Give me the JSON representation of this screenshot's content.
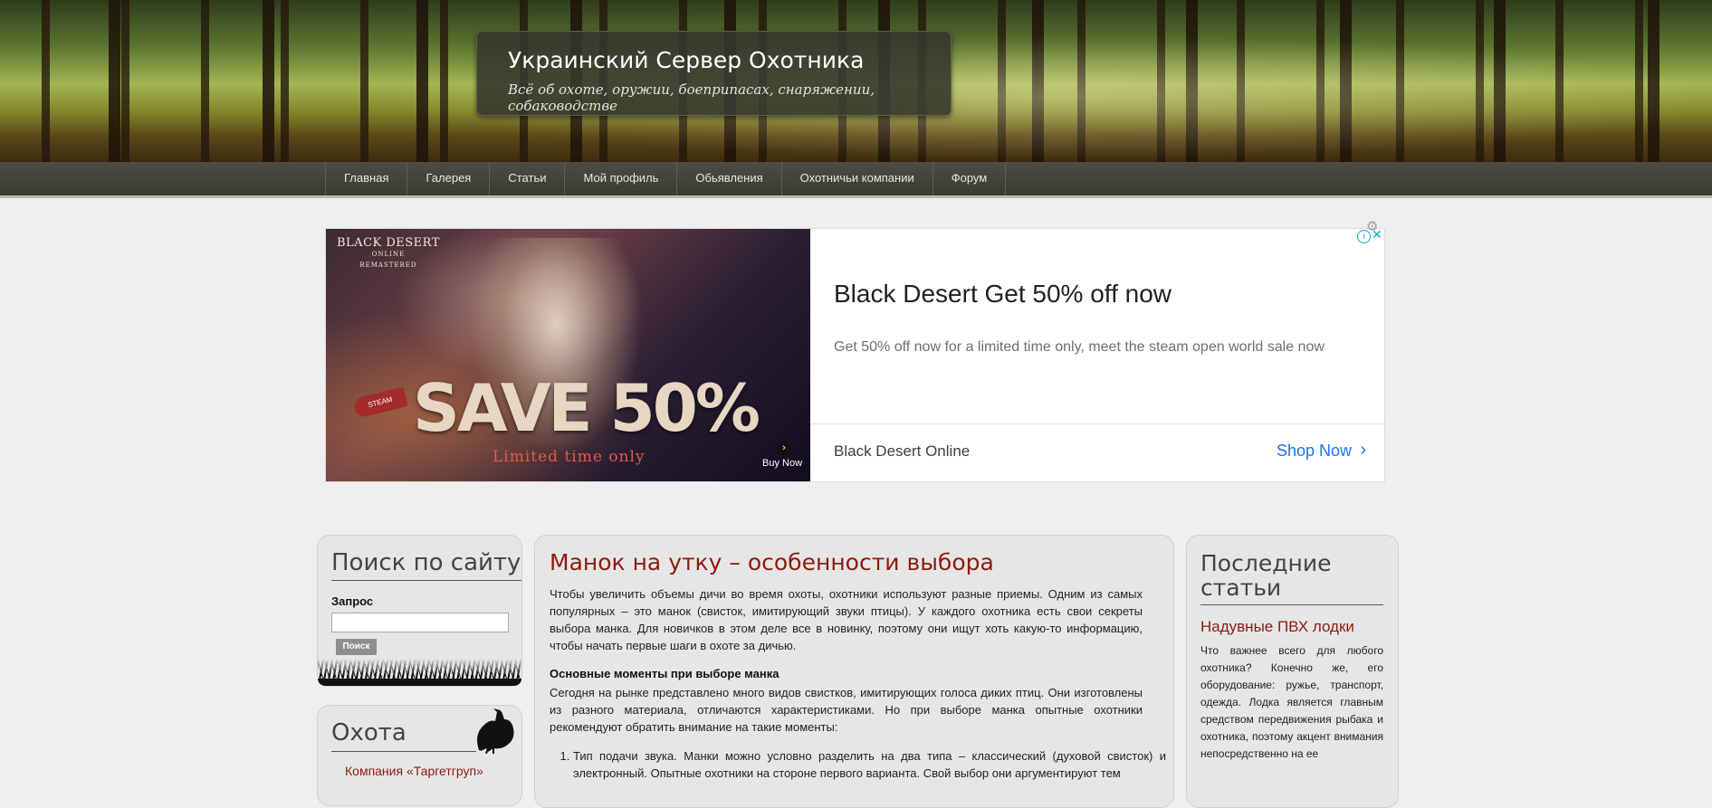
{
  "site": {
    "title": "Украинский Сервер Охотника",
    "tagline": "Всё об охоте, оружии, боеприпасах, снаряжении, собаководстве"
  },
  "nav": {
    "items": [
      "Главная",
      "Галерея",
      "Статьи",
      "Мой профиль",
      "Обьявления",
      "Охотничьи компании",
      "Форум"
    ]
  },
  "ad": {
    "brand_line1": "BLACK DESERT",
    "brand_line2": "ONLINE",
    "brand_line3": "REMASTERED",
    "steam_tag": "STEAM",
    "save_text": "SAVE 50%",
    "limited_text": "Limited time only",
    "buy_now": "Buy Now",
    "headline": "Black Desert Get 50% off now",
    "description": "Get 50% off now for a limited time only, meet the steam open world sale now",
    "advertiser": "Black Desert Online",
    "cta": "Shop Now",
    "info_icon": "info-icon",
    "close_icon": "close-icon",
    "gear_icon": "gear-icon"
  },
  "search": {
    "heading": "Поиск по сайту",
    "label": "Запрос",
    "placeholder": "",
    "value": "",
    "button": "Поиск"
  },
  "hunting": {
    "heading": "Охота",
    "links": [
      "Компания «Таргетгруп»"
    ],
    "icon": "grouse-icon"
  },
  "article": {
    "title": "Манок на утку – особенности выбора",
    "intro": "Чтобы увеличить объемы дичи во время охоты, охотники используют разные приемы. Одним из самых популярных – это манок (свисток, имитирующий звуки птицы). У каждого охотника есть свои секреты выбора манка. Для новичков в этом деле все в новинку, поэтому они ищут хоть какую-то информацию, чтобы начать первые шаги в охоте за дичью.",
    "subheading": "Основные моменты при выборе манка",
    "paragraph2": "Сегодня на рынке представлено много видов свистков, имитирующих голоса диких птиц. Они изготовлены из разного материала, отличаются характеристиками. Но при выборе манка опытные охотники рекомендуют обратить внимание на такие моменты:",
    "list": [
      "Тип подачи звука. Манки можно условно разделить на два типа – классический (духовой свисток) и электронный. Опытные охотники на стороне первого варианта. Свой выбор они аргументируют тем"
    ]
  },
  "recent": {
    "heading": "Последние статьи",
    "link": "Надувные ПВХ лодки",
    "excerpt": "Что важнее всего для любого охотника? Конечно же, его оборудование: ружье, транспорт, одежда. Лодка является главным средством передвижения рыбака и охотника, поэтому акцент внимания непосредственно на ее"
  },
  "colors": {
    "accent_red": "#8e1a0e",
    "nav_bg": "#3f4136",
    "page_bg": "#efefef",
    "panel_bg": "#e6e6e6",
    "ad_link": "#1a73e8"
  }
}
